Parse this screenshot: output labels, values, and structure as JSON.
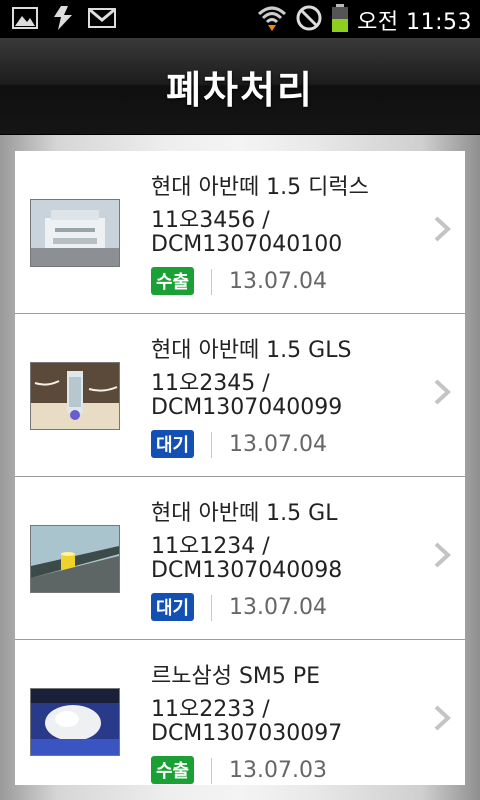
{
  "status_bar": {
    "time": "오전 11:53",
    "icons": [
      "gallery-icon",
      "usb-debug-icon",
      "gmail-icon",
      "wifi-icon",
      "no-signal-icon",
      "battery-icon"
    ],
    "battery_level": 0.5
  },
  "header": {
    "title": "폐차처리"
  },
  "colors": {
    "badge_out": "#1aa035",
    "badge_wait": "#1250b4"
  },
  "items": [
    {
      "car": "현대 아반떼 1.5 디럭스",
      "plate": "11오3456 /",
      "doc": "DCM1307040100",
      "status": "수출",
      "status_type": "out",
      "date": "13.07.04",
      "thumb": "printer-photo"
    },
    {
      "car": "현대 아반떼 1.5 GLS",
      "plate": "11오2345 /",
      "doc": "DCM1307040099",
      "status": "대기",
      "status_type": "wait",
      "date": "13.07.04",
      "thumb": "glass-lamp-photo"
    },
    {
      "car": "현대 아반떼 1.5 GL",
      "plate": "11오1234 /",
      "doc": "DCM1307040098",
      "status": "대기",
      "status_type": "wait",
      "date": "13.07.04",
      "thumb": "window-cup-photo"
    },
    {
      "car": "르노삼성 SM5 PE",
      "plate": "11오2233 /",
      "doc": "DCM1307030097",
      "status": "수출",
      "status_type": "out",
      "date": "13.07.03",
      "thumb": "mouse-photo"
    }
  ]
}
